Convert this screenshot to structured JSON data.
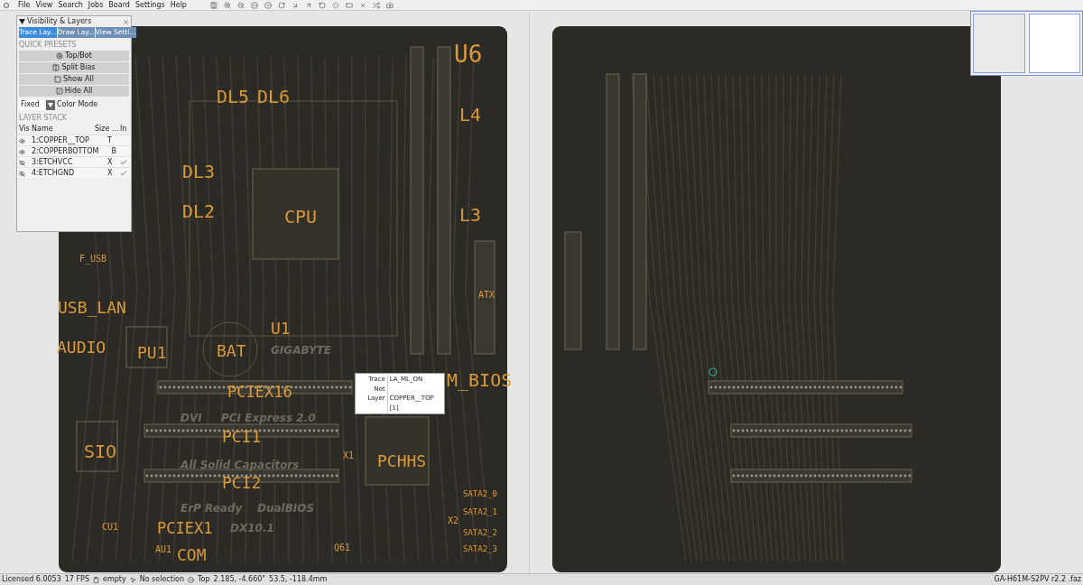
{
  "menu": [
    "File",
    "View",
    "Search",
    "Jobs",
    "Board",
    "Settings",
    "Help"
  ],
  "panel": {
    "title": "Visibility & Layers",
    "tabs": [
      {
        "label": "Trace Lay...",
        "selected": true
      },
      {
        "label": "Draw Lay...",
        "selected": false
      },
      {
        "label": "View Setti...",
        "selected": false
      }
    ],
    "presets_heading": "QUICK PRESETS",
    "presets": [
      "Top/Bot",
      "Split Bias",
      "Show All",
      "Hide All"
    ],
    "color_mode": {
      "value": "Fixed",
      "label": "Color Mode"
    },
    "stack_heading": "LAYER STACK",
    "columns": [
      "Vis",
      "Name",
      "Size ...",
      "In"
    ],
    "layers": [
      {
        "name": "1:COPPER__TOP",
        "visible": true,
        "side": "T",
        "checked": false
      },
      {
        "name": "2:COPPERBOTTOM",
        "visible": true,
        "side": "B",
        "checked": false
      },
      {
        "name": "3:ETCHVCC",
        "visible": false,
        "side": "X",
        "checked": true
      },
      {
        "name": "4:ETCHGND",
        "visible": false,
        "side": "X",
        "checked": true
      }
    ]
  },
  "board_labels": [
    "U6",
    "L4",
    "DL5",
    "DL6",
    "DL3",
    "DL2",
    "CPU",
    "L3",
    "F_USB",
    "USB_LAN",
    "AUDIO",
    "PU1",
    "BAT",
    "U1",
    "PCIEX16",
    "M_BIOS",
    "SIO",
    "PCI1",
    "PCI2",
    "PCHHS",
    "X1",
    "PCIEX1",
    "COM",
    "ATX",
    "SATA2_0",
    "SATA2_1",
    "SATA2_2",
    "SATA2_3",
    "X2",
    "Q61",
    "CU1",
    "AU1"
  ],
  "silkscreen": [
    "GIGABYTE",
    "DVI",
    "PCI Express 2.0",
    "All Solid Capacitors",
    "ErP Ready",
    "DualBIOS",
    "DX10.1"
  ],
  "tooltip": [
    {
      "key": "Trace Net",
      "value": "LA_ML_ON"
    },
    {
      "key": "Layer",
      "value": "COPPER__TOP [1]"
    }
  ],
  "status": {
    "license": "Licensed 6.0053",
    "fps": "17 FPS",
    "clipboard": "empty",
    "selection": "No selection",
    "side": "Top",
    "coords_in": "2.185, -4.660\"",
    "coords_mm": "53.5, -118.4mm",
    "file": "GA-H61M-S2PV r2.2 .faz"
  }
}
